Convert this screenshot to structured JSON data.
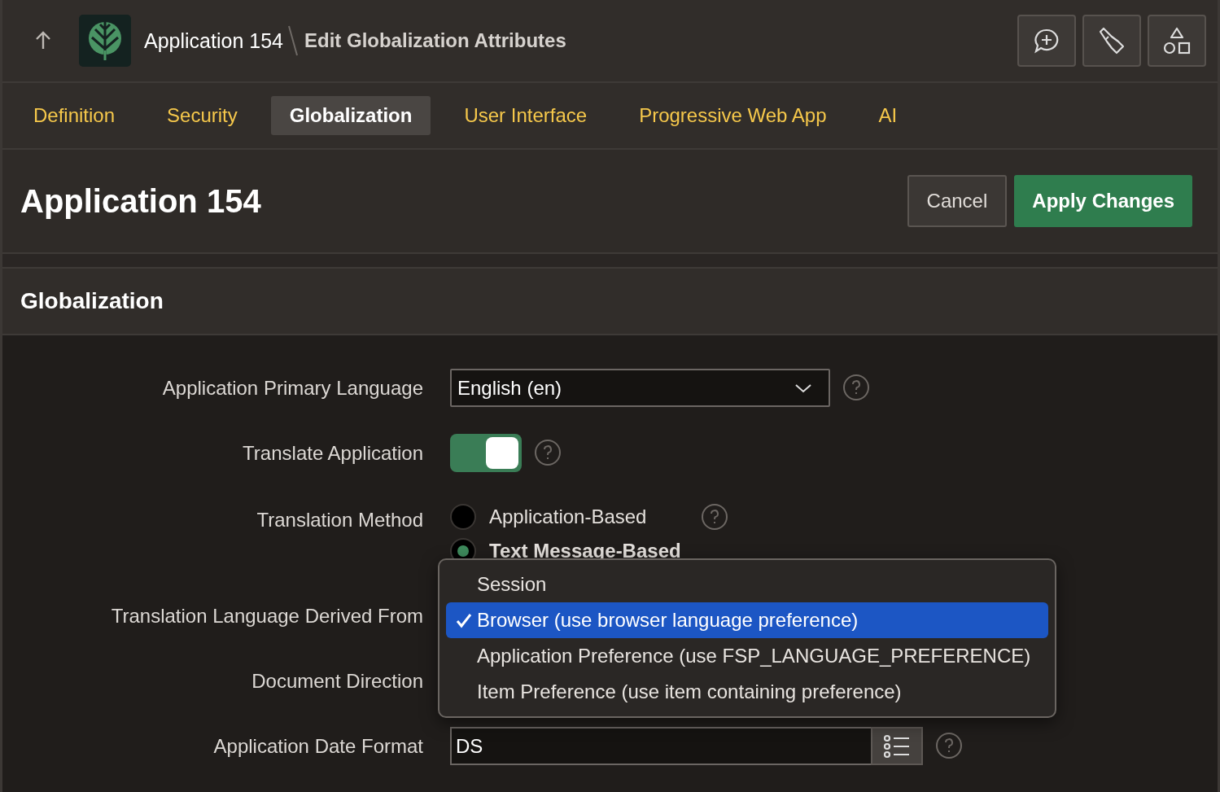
{
  "breadcrumb": {
    "app": "Application 154",
    "page": "Edit Globalization Attributes"
  },
  "tabs": [
    {
      "label": "Definition",
      "selected": false
    },
    {
      "label": "Security",
      "selected": false
    },
    {
      "label": "Globalization",
      "selected": true
    },
    {
      "label": "User Interface",
      "selected": false
    },
    {
      "label": "Progressive Web App",
      "selected": false
    },
    {
      "label": "AI",
      "selected": false
    }
  ],
  "header": {
    "title": "Application 154",
    "buttons": [
      {
        "label": "Cancel",
        "kind": "secondary"
      },
      {
        "label": "Apply Changes",
        "kind": "primary"
      }
    ]
  },
  "region": {
    "title": "Globalization"
  },
  "fields": [
    {
      "kind": "select",
      "label": "Application Primary Language",
      "value": "English (en)"
    },
    {
      "kind": "toggle",
      "label": "Translate Application",
      "on": true
    },
    {
      "kind": "radio",
      "label": "Translation Method",
      "options": [
        {
          "label": "Application-Based",
          "selected": false
        },
        {
          "label": "Text Message-Based",
          "selected": true
        }
      ]
    },
    {
      "kind": "covered",
      "label": "Translation Language Derived From"
    },
    {
      "kind": "covered",
      "label": "Document Direction"
    },
    {
      "kind": "picker",
      "label": "Application Date Format",
      "value": "DS"
    }
  ],
  "dropdown": {
    "options": [
      {
        "label": "Session",
        "selected": false
      },
      {
        "label": "Browser (use browser language preference)",
        "selected": true
      },
      {
        "label": "Application Preference (use FSP_LANGUAGE_PREFERENCE)",
        "selected": false
      },
      {
        "label": "Item Preference (use item containing preference)",
        "selected": false
      }
    ]
  }
}
